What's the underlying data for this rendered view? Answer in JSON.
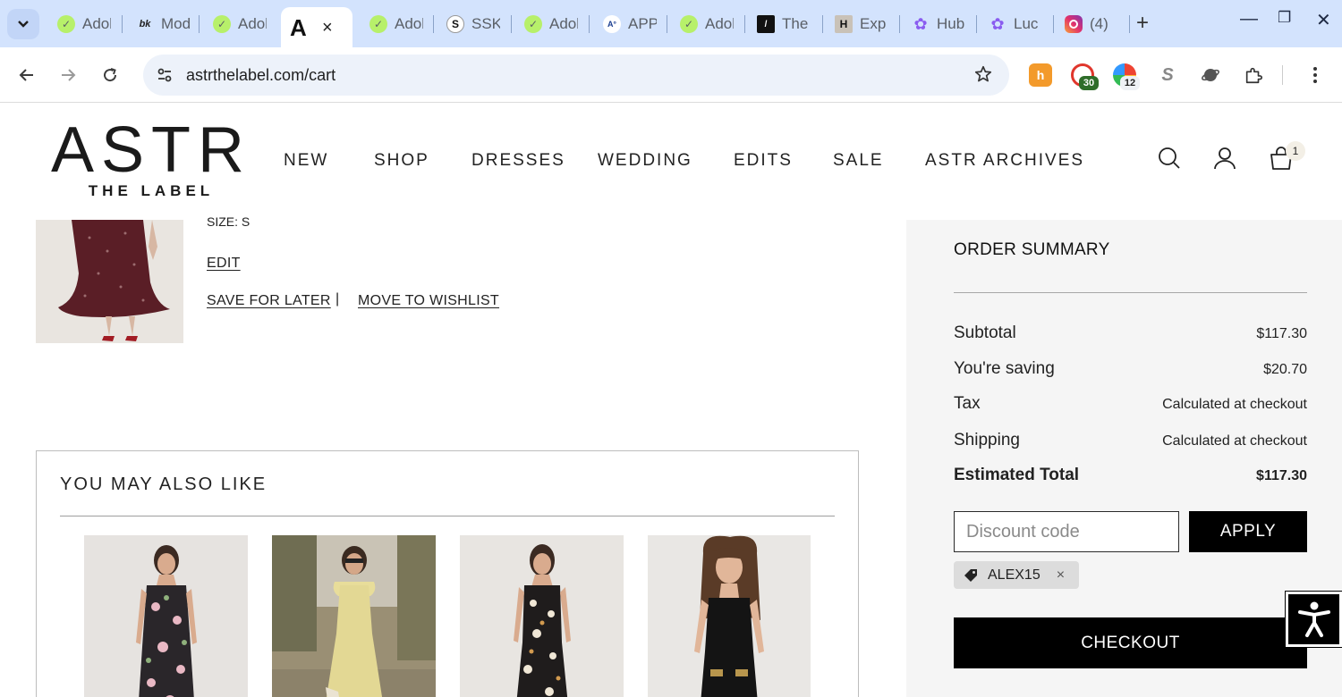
{
  "browser": {
    "tabs": [
      {
        "title": "Adobe",
        "favicon": "green-check-icon"
      },
      {
        "title": "Mod",
        "favicon": "book-icon"
      },
      {
        "title": "Adobe",
        "favicon": "green-check-icon"
      },
      {
        "title": "Adobe",
        "favicon": "green-check-icon"
      },
      {
        "title": "SSK",
        "favicon": "s-icon"
      },
      {
        "title": "Adobe",
        "favicon": "green-check-icon"
      },
      {
        "title": "APP",
        "favicon": "ap-icon"
      },
      {
        "title": "Adobe",
        "favicon": "green-check-icon"
      },
      {
        "title": "The",
        "favicon": "theory-icon"
      },
      {
        "title": "Exp",
        "favicon": "h-icon"
      },
      {
        "title": "Hub",
        "favicon": "purple-flower-icon"
      },
      {
        "title": "Luc",
        "favicon": "purple-flower-icon"
      },
      {
        "title": "(4)",
        "favicon": "instagram-icon"
      }
    ],
    "active_tab": {
      "close": "×"
    },
    "url": "astrthelabel.com/cart",
    "extensions": [
      {
        "name": "honey-icon",
        "glyph": "h"
      },
      {
        "name": "red-extension-icon",
        "badge": "30"
      },
      {
        "name": "rainbow-extension-icon",
        "badge": "12"
      },
      {
        "name": "s-extension-icon",
        "glyph": "S"
      },
      {
        "name": "planet-extension-icon"
      },
      {
        "name": "puzzle-extensions-icon"
      }
    ],
    "colors": {
      "tabstrip": "#d3e3fd",
      "omnibox": "#edf2fa"
    }
  },
  "site": {
    "logo_main": "ASTR",
    "logo_sub": "THE LABEL",
    "nav": [
      "NEW",
      "SHOP",
      "DRESSES",
      "WEDDING",
      "EDITS",
      "SALE",
      "ASTR ARCHIVES"
    ],
    "cart_count": "1"
  },
  "cart_item": {
    "size_line": "SIZE: S",
    "edit_label": "EDIT",
    "save_label": "SAVE FOR LATER",
    "separator": "|",
    "wishlist_label": "MOVE TO WISHLIST"
  },
  "recommendations": {
    "title": "YOU MAY ALSO LIKE"
  },
  "summary": {
    "title": "ORDER SUMMARY",
    "rows": [
      {
        "label": "Subtotal",
        "value": "$117.30"
      },
      {
        "label": "You're saving",
        "value": "$20.70"
      },
      {
        "label": "Tax",
        "value": "Calculated at checkout"
      },
      {
        "label": "Shipping",
        "value": "Calculated at checkout"
      },
      {
        "label": "Estimated Total",
        "value": "$117.30"
      }
    ],
    "discount_placeholder": "Discount code",
    "apply_label": "APPLY",
    "applied_code": "ALEX15",
    "chip_close": "×",
    "checkout_label": "CHECKOUT"
  }
}
